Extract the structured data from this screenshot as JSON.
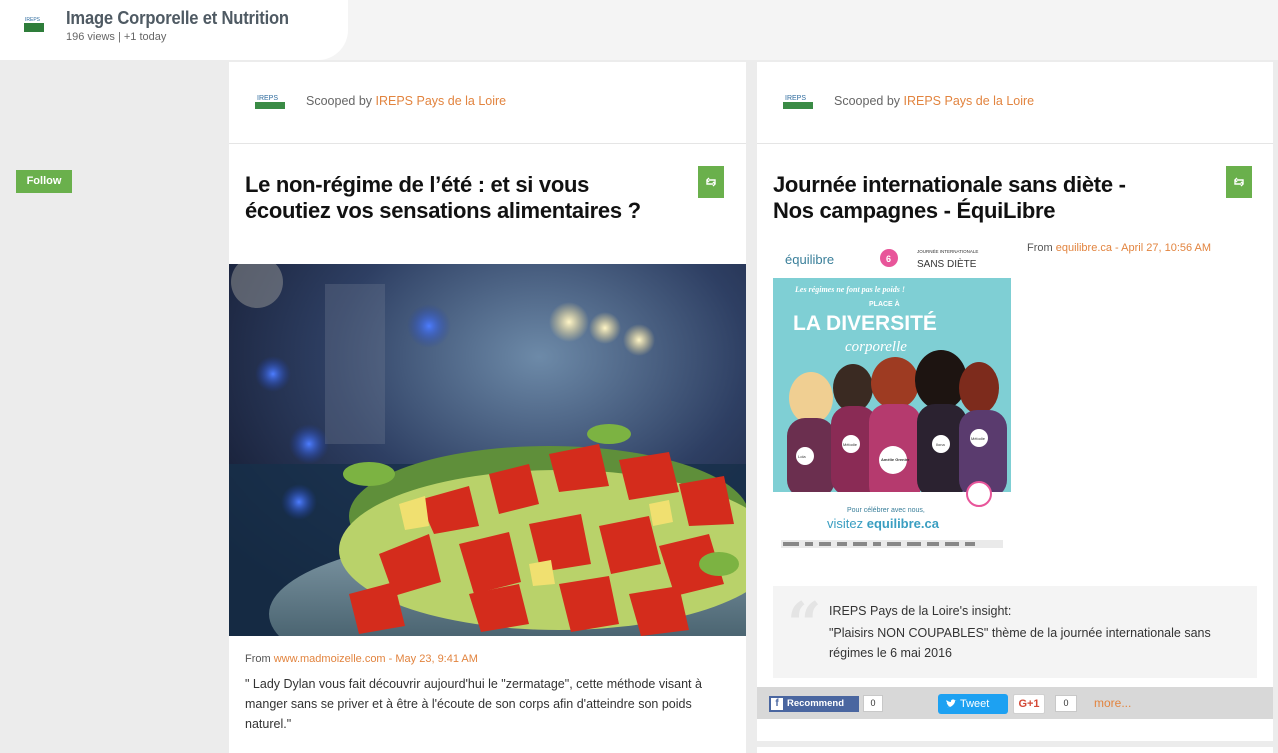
{
  "topic": {
    "title": "Image Corporelle et Nutrition",
    "stats": "196 views | +1 today",
    "logo_text": "IREPS"
  },
  "follow_label": "Follow",
  "posts": [
    {
      "scooped_prefix": "Scooped by ",
      "curator": "IREPS Pays de la Loire",
      "rescoop_icon": "rescoop-icon",
      "title": "Le non-régime de l’été : et si vous écoutiez vos sensations alimentaires ?",
      "source_prefix": "From ",
      "source_link": "www.madmoizelle.com",
      "source_date": " - May 23, 9:41 AM",
      "description": "\" Lady Dylan vous fait découvrir aujourd'hui le \"zermatage\", cette méthode visant à manger sans se priver et à être à l'écoute de son corps afin d'atteindre son poids naturel.\""
    },
    {
      "scooped_prefix": "Scooped by ",
      "curator": "IREPS Pays de la Loire",
      "rescoop_icon": "rescoop-icon",
      "title": "Journée internationale sans diète - Nos campagnes - ÉquiLibre",
      "source_prefix": "From ",
      "source_link": "equilibre.ca",
      "source_date": " - April 27, 10:56 AM",
      "poster": {
        "brand": "équilibre",
        "day_number": "6",
        "day_month": "MAI",
        "event_small": "JOURNÉE INTERNATIONALE",
        "event_big": "SANS DIÈTE",
        "tagline": "Les régimes ne font pas le poids !",
        "place_a": "PLACE À",
        "headline": "LA DIVERSITÉ",
        "subhead": "corporelle",
        "cta_small": "Pour célébrer avec nous,",
        "cta_big_prefix": "visitez ",
        "cta_big_link": "equilibre.ca",
        "name_tags": [
          "Lola",
          "Mélodie",
          "Amélie Grenier",
          "Ilona",
          "Mélodie"
        ]
      },
      "insight_label": "IREPS Pays de la Loire's insight:",
      "insight_text": "\"Plaisirs NON COUPABLES\" thème de la journée internationale sans régimes le 6 mai 2016",
      "share": {
        "recommend": "Recommend",
        "recommend_count": "0",
        "tweet": "Tweet",
        "gplus": "G+1",
        "gplus_count": "0",
        "more": "more..."
      }
    }
  ],
  "colors": {
    "accent_orange": "#e2843f",
    "follow_green": "#6ab04c",
    "facebook_blue": "#4a66a0",
    "twitter_blue": "#1da1f2"
  }
}
